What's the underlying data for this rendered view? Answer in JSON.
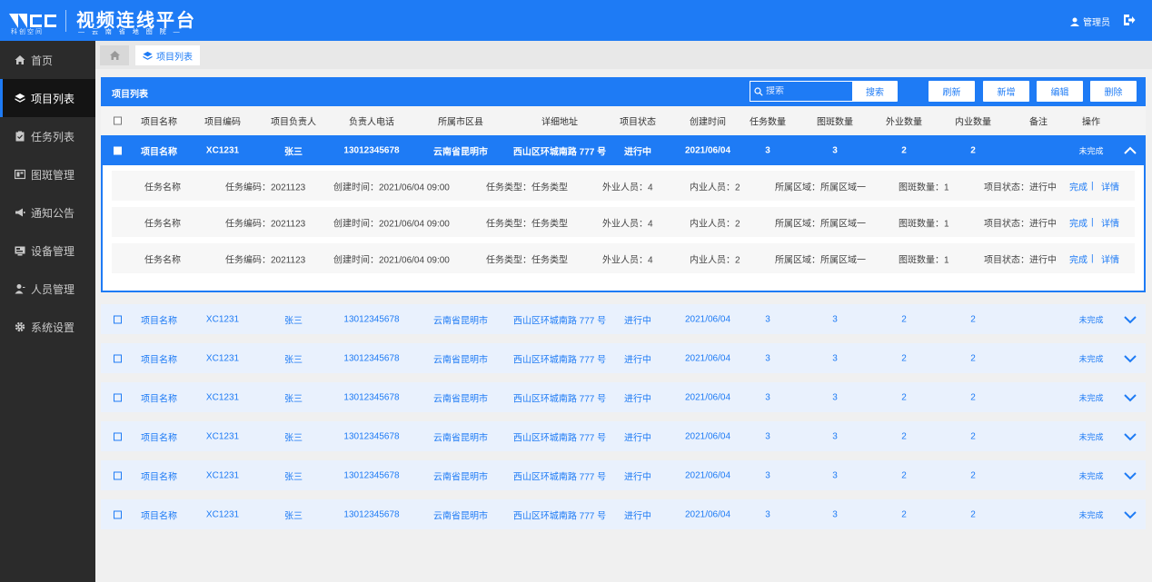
{
  "header": {
    "logo_sub": "科创空间",
    "title": "视频连线平台",
    "subtitle": "— 云 南 省 地 图 院 —",
    "user": "管理员"
  },
  "sidebar": {
    "items": [
      {
        "label": "首页",
        "icon": "home-icon"
      },
      {
        "label": "项目列表",
        "icon": "layers-icon"
      },
      {
        "label": "任务列表",
        "icon": "clipboard-icon"
      },
      {
        "label": "图斑管理",
        "icon": "map-icon"
      },
      {
        "label": "通知公告",
        "icon": "megaphone-icon"
      },
      {
        "label": "设备管理",
        "icon": "device-icon"
      },
      {
        "label": "人员管理",
        "icon": "person-icon"
      },
      {
        "label": "系统设置",
        "icon": "gear-icon"
      }
    ]
  },
  "breadcrumb": {
    "tab": "项目列表"
  },
  "panel": {
    "title": "项目列表",
    "search_placeholder": "搜索",
    "search_button": "搜索",
    "buttons": {
      "refresh": "刷新",
      "add": "新增",
      "edit": "编辑",
      "delete": "删除"
    }
  },
  "table": {
    "columns": [
      "项目名称",
      "项目编码",
      "项目负责人",
      "负责人电话",
      "所属市区县",
      "详细地址",
      "项目状态",
      "创建时间",
      "任务数量",
      "图斑数量",
      "外业数量",
      "内业数量",
      "备注",
      "操作"
    ],
    "rows": [
      {
        "name": "项目名称",
        "code": "XC1231",
        "owner": "张三",
        "phone": "13012345678",
        "city": "云南省昆明市",
        "address": "西山区环城南路 777 号",
        "status": "进行中",
        "date": "2021/06/04",
        "tasks": "3",
        "spots": "3",
        "field": "2",
        "office": "2",
        "op": "未完成"
      },
      {
        "name": "项目名称",
        "code": "XC1231",
        "owner": "张三",
        "phone": "13012345678",
        "city": "云南省昆明市",
        "address": "西山区环城南路 777 号",
        "status": "进行中",
        "date": "2021/06/04",
        "tasks": "3",
        "spots": "3",
        "field": "2",
        "office": "2",
        "op": "未完成"
      },
      {
        "name": "项目名称",
        "code": "XC1231",
        "owner": "张三",
        "phone": "13012345678",
        "city": "云南省昆明市",
        "address": "西山区环城南路 777 号",
        "status": "进行中",
        "date": "2021/06/04",
        "tasks": "3",
        "spots": "3",
        "field": "2",
        "office": "2",
        "op": "未完成"
      },
      {
        "name": "项目名称",
        "code": "XC1231",
        "owner": "张三",
        "phone": "13012345678",
        "city": "云南省昆明市",
        "address": "西山区环城南路 777 号",
        "status": "进行中",
        "date": "2021/06/04",
        "tasks": "3",
        "spots": "3",
        "field": "2",
        "office": "2",
        "op": "未完成"
      },
      {
        "name": "项目名称",
        "code": "XC1231",
        "owner": "张三",
        "phone": "13012345678",
        "city": "云南省昆明市",
        "address": "西山区环城南路 777 号",
        "status": "进行中",
        "date": "2021/06/04",
        "tasks": "3",
        "spots": "3",
        "field": "2",
        "office": "2",
        "op": "未完成"
      },
      {
        "name": "项目名称",
        "code": "XC1231",
        "owner": "张三",
        "phone": "13012345678",
        "city": "云南省昆明市",
        "address": "西山区环城南路 777 号",
        "status": "进行中",
        "date": "2021/06/04",
        "tasks": "3",
        "spots": "3",
        "field": "2",
        "office": "2",
        "op": "未完成"
      },
      {
        "name": "项目名称",
        "code": "XC1231",
        "owner": "张三",
        "phone": "13012345678",
        "city": "云南省昆明市",
        "address": "西山区环城南路 777 号",
        "status": "进行中",
        "date": "2021/06/04",
        "tasks": "3",
        "spots": "3",
        "field": "2",
        "office": "2",
        "op": "未完成"
      }
    ],
    "details": [
      {
        "name": "任务名称",
        "code": "任务编码：2021123",
        "created": "创建时间：2021/06/04 09:00",
        "type": "任务类型：任务类型",
        "field": "外业人员：4",
        "office": "内业人员：2",
        "area": "所属区域：所属区域一",
        "spots": "图斑数量：1",
        "status": "项目状态：进行中",
        "done": "完成",
        "sep": "|",
        "detail": "详情"
      },
      {
        "name": "任务名称",
        "code": "任务编码：2021123",
        "created": "创建时间：2021/06/04 09:00",
        "type": "任务类型：任务类型",
        "field": "外业人员：4",
        "office": "内业人员：2",
        "area": "所属区域：所属区域一",
        "spots": "图斑数量：1",
        "status": "项目状态：进行中",
        "done": "完成",
        "sep": "|",
        "detail": "详情"
      },
      {
        "name": "任务名称",
        "code": "任务编码：2021123",
        "created": "创建时间：2021/06/04 09:00",
        "type": "任务类型：任务类型",
        "field": "外业人员：4",
        "office": "内业人员：2",
        "area": "所属区域：所属区域一",
        "spots": "图斑数量：1",
        "status": "项目状态：进行中",
        "done": "完成",
        "sep": "|",
        "detail": "详情"
      }
    ]
  },
  "colors": {
    "accent": "#1e7bf5",
    "sidebar": "#2b2b2b",
    "row_bg": "#e9f1fd"
  }
}
